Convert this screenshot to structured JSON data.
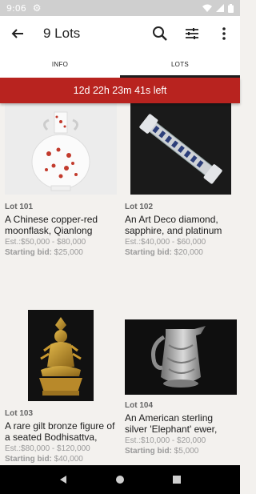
{
  "status": {
    "time": "9:06"
  },
  "app_bar": {
    "title": "9 Lots"
  },
  "tabs": [
    {
      "label": "INFO",
      "active": false
    },
    {
      "label": "LOTS",
      "active": true
    }
  ],
  "countdown": {
    "text": "12d 22h 23m 41s left"
  },
  "lots": [
    {
      "number": "Lot 101",
      "title": "A Chinese copper-red moonflask, Qianlong",
      "estimate": "Est.:$50,000 - $80,000",
      "starting_label": "Starting bid:",
      "starting_value": "$25,000"
    },
    {
      "number": "Lot 102",
      "title": "An Art Deco diamond, sapphire, and platinum",
      "estimate": "Est.:$40,000 - $60,000",
      "starting_label": "Starting bid:",
      "starting_value": "$20,000"
    },
    {
      "number": "Lot 103",
      "title": "A rare gilt bronze figure of a seated Bodhisattva,",
      "estimate": "Est.:$80,000 - $120,000",
      "starting_label": "Starting bid:",
      "starting_value": "$40,000"
    },
    {
      "number": "Lot 104",
      "title": "An American sterling silver 'Elephant' ewer,",
      "estimate": "Est.:$10,000 - $20,000",
      "starting_label": "Starting bid:",
      "starting_value": "$5,000"
    }
  ],
  "colors": {
    "accent_red": "#b8231f",
    "status_bar": "#cfcfcf"
  }
}
